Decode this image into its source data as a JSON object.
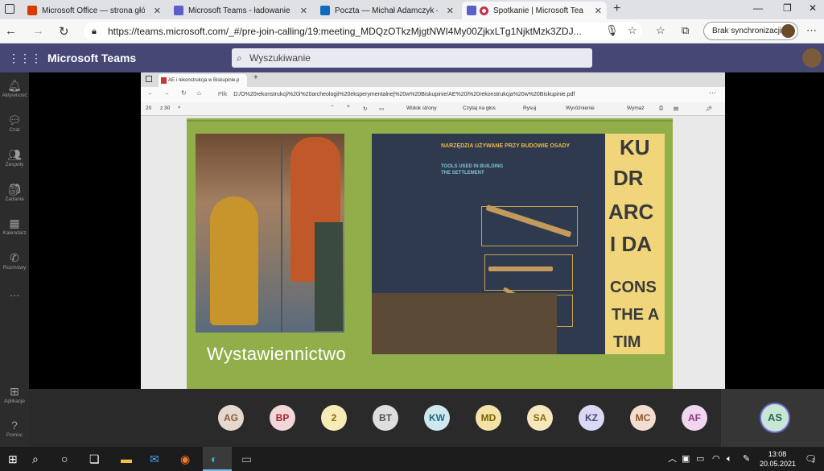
{
  "browser": {
    "tabs": [
      {
        "title": "Microsoft Office — strona główn",
        "icon": "office-icon",
        "color": "#d83b01"
      },
      {
        "title": "Microsoft Teams - ładowanie",
        "icon": "teams-icon",
        "color": "#5b5fc7"
      },
      {
        "title": "Poczta — Michał Adamczyk — O",
        "icon": "outlook-icon",
        "color": "#0f6cbd"
      },
      {
        "title": "Spotkanie | Microsoft Teams",
        "icon": "teams-recording-icon",
        "color": "#c4314b"
      }
    ],
    "url": "https://teams.microsoft.com/_#/pre-join-calling/19:meeting_MDQzOTkzMjgtNWI4My00ZjkxLTg1NjktMzk3ZDJ...",
    "sync_label": "Brak synchronizacji"
  },
  "teams": {
    "app_name": "Microsoft Teams",
    "search_placeholder": "Wyszukiwanie",
    "rail": [
      {
        "label": "Aktywność",
        "icon": "bell-icon"
      },
      {
        "label": "Czat",
        "icon": "chat-icon"
      },
      {
        "label": "Zespoły",
        "icon": "teams-group-icon"
      },
      {
        "label": "Zadania",
        "icon": "tasks-icon"
      },
      {
        "label": "Kalendarz",
        "icon": "calendar-icon"
      },
      {
        "label": "Rozmowy",
        "icon": "phone-icon"
      },
      {
        "label": "Aplikacje",
        "icon": "apps-icon"
      },
      {
        "label": "Pomoc",
        "icon": "help-icon"
      }
    ]
  },
  "shared": {
    "tab_title": "AE i rekonstrukcja w Biskupinie.p",
    "url_prefix": "Plik",
    "url": "D:/O%20rekonstrukcji%20i%20archeologii%20eksperymentalnej%20w%20Biskupinie/AE%20i%20rekonstrukcja%20w%20Biskupinie.pdf",
    "page_num": "20",
    "page_total": "z 30",
    "tools": [
      "Widok strony",
      "Czytaj na głos",
      "Rysuj",
      "Wyróżnienie",
      "Wymaż"
    ],
    "slide": {
      "caption": "Wystawiennictwo",
      "heading_pl": "NARZĘDZIA UŻYWANE PRZY BUDOWIE OSADY",
      "heading_en": "TOOLS USED IN BUILDING THE SETTLEMENT",
      "poster_lines": [
        "KU",
        "DR",
        "ARC",
        "I DA",
        "CONS",
        "THE A",
        "TIM"
      ]
    }
  },
  "participants": [
    {
      "initials": "AG",
      "bg": "#e6d8cf",
      "fg": "#8a5a3c"
    },
    {
      "initials": "BP",
      "bg": "#f3d6d8",
      "fg": "#a4262c"
    },
    {
      "initials": "2",
      "bg": "#f7ecb5",
      "fg": "#8a6d00"
    },
    {
      "initials": "BT",
      "bg": "#dedede",
      "fg": "#555555"
    },
    {
      "initials": "KW",
      "bg": "#cfe7ee",
      "fg": "#1b6b83"
    },
    {
      "initials": "MD",
      "bg": "#f4e3a6",
      "fg": "#7f6000"
    },
    {
      "initials": "SA",
      "bg": "#f6e7bd",
      "fg": "#8a6d00"
    },
    {
      "initials": "KZ",
      "bg": "#d9d9f3",
      "fg": "#464775"
    },
    {
      "initials": "MC",
      "bg": "#f2ddcf",
      "fg": "#8e562e"
    },
    {
      "initials": "AF",
      "bg": "#f0d7ee",
      "fg": "#8f3585"
    }
  ],
  "self": {
    "initials": "AS"
  },
  "taskbar": {
    "time": "13:08",
    "date": "20.05.2021",
    "notifications": "1"
  }
}
